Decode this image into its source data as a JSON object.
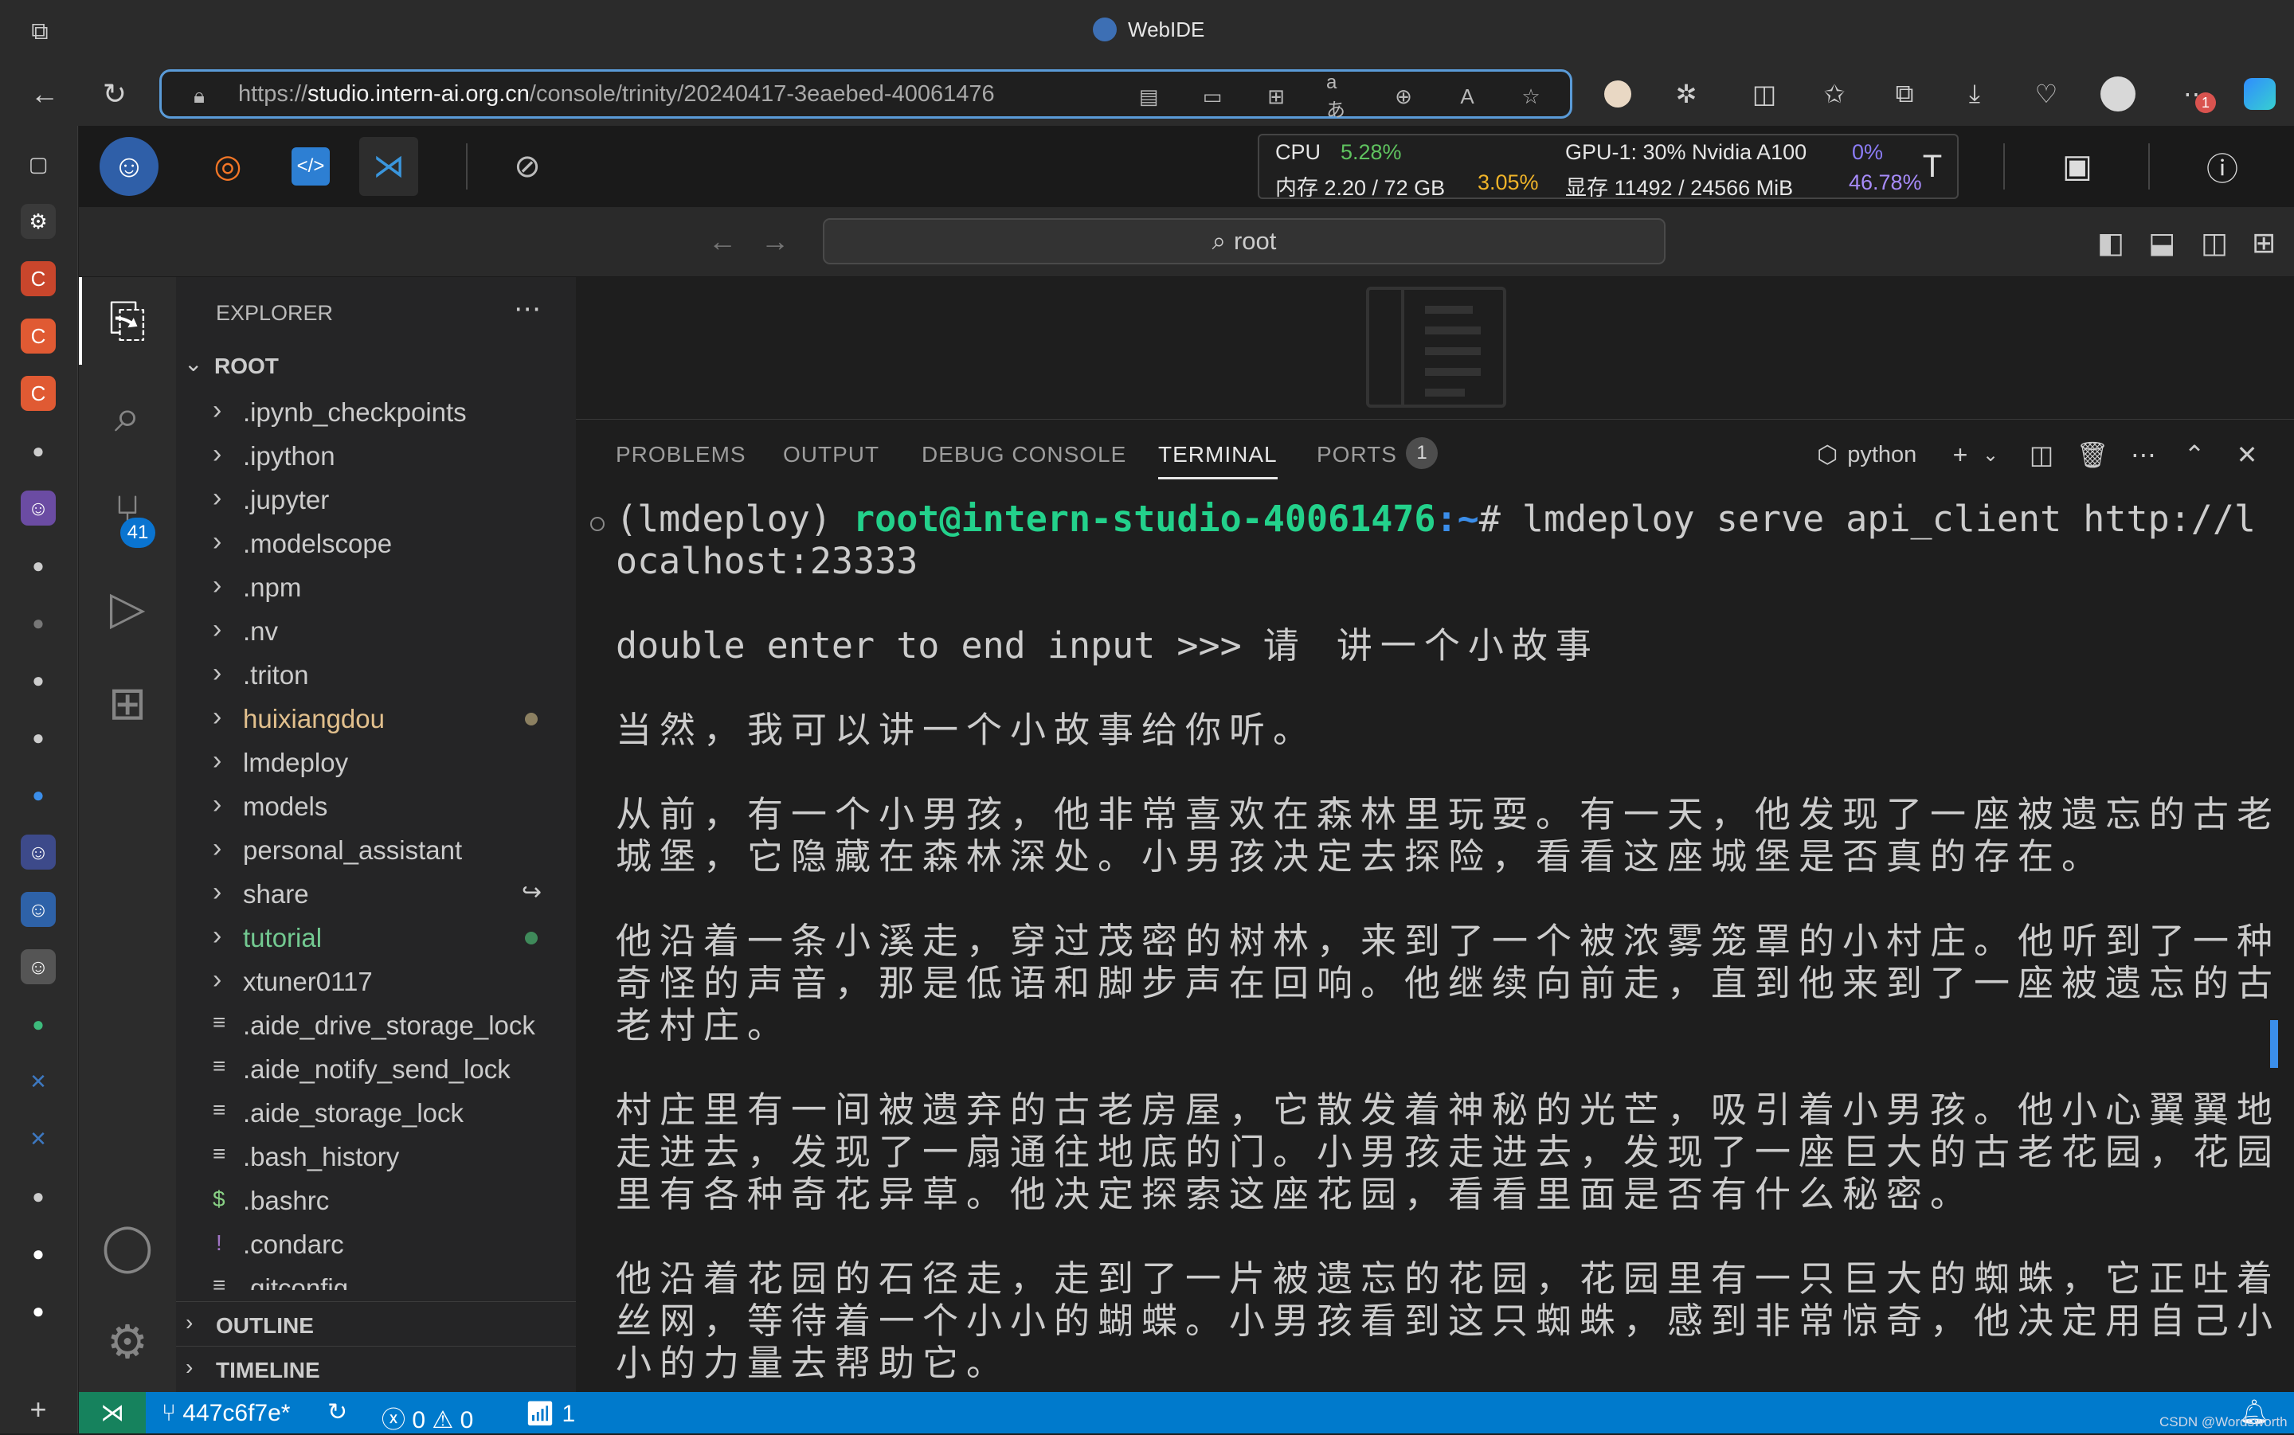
{
  "browser": {
    "window_title": "WebIDE",
    "url_prefix": "https://",
    "url_host": "studio.intern-ai.org.cn",
    "url_path": "/console/trinity/20240417-3eaebed-40061476",
    "download_badge": "1"
  },
  "ide_toolbar": {
    "cpu_label": "CPU",
    "cpu_value": "5.28%",
    "mem_label": "内存 2.20 / 72 GB",
    "mem_value": "3.05%",
    "gpu_label": "GPU-1: 30% Nvidia A100",
    "gpu_value": "0%",
    "vram_label": "显存 11492 / 24566 MiB",
    "vram_value": "46.78%"
  },
  "command_center": {
    "text": "root"
  },
  "activity": {
    "scm_badge": "41"
  },
  "explorer": {
    "title": "EXPLORER",
    "root": "ROOT",
    "items": [
      {
        "name": ".ipynb_checkpoints",
        "type": "folder"
      },
      {
        "name": ".ipython",
        "type": "folder"
      },
      {
        "name": ".jupyter",
        "type": "folder"
      },
      {
        "name": ".modelscope",
        "type": "folder"
      },
      {
        "name": ".npm",
        "type": "folder"
      },
      {
        "name": ".nv",
        "type": "folder"
      },
      {
        "name": ".triton",
        "type": "folder"
      },
      {
        "name": "huixiangdou",
        "type": "folder",
        "status": "modified"
      },
      {
        "name": "lmdeploy",
        "type": "folder"
      },
      {
        "name": "models",
        "type": "folder"
      },
      {
        "name": "personal_assistant",
        "type": "folder"
      },
      {
        "name": "share",
        "type": "folder",
        "status": "symlink"
      },
      {
        "name": "tutorial",
        "type": "folder",
        "status": "untracked"
      },
      {
        "name": "xtuner0117",
        "type": "folder"
      },
      {
        "name": ".aide_drive_storage_lock",
        "type": "file"
      },
      {
        "name": ".aide_notify_send_lock",
        "type": "file"
      },
      {
        "name": ".aide_storage_lock",
        "type": "file"
      },
      {
        "name": ".bash_history",
        "type": "file"
      },
      {
        "name": ".bashrc",
        "type": "file",
        "icon": "$"
      },
      {
        "name": ".condarc",
        "type": "file",
        "icon": "!"
      },
      {
        "name": ".gitconfig",
        "type": "file"
      }
    ],
    "outline": "OUTLINE",
    "timeline": "TIMELINE"
  },
  "panel": {
    "tabs": [
      "PROBLEMS",
      "OUTPUT",
      "DEBUG CONSOLE",
      "TERMINAL",
      "PORTS"
    ],
    "active_tab": "TERMINAL",
    "ports_badge": "1",
    "shell_name": "python"
  },
  "terminal": {
    "env": "(lmdeploy) ",
    "user_host": "root@intern-studio-40061476",
    "path": ":~",
    "prompt_end": "# ",
    "command_line1": "lmdeploy serve api_client http://l",
    "command_line2": "ocalhost:23333",
    "input_prompt": "double enter to end input >>> ",
    "user_input": "请 讲一个小故事",
    "p1": "当然，我可以讲一个小故事给你听。",
    "p2_l1": "从前，有一个小男孩，他非常喜欢在森林里玩耍。有一天，他发现了一座被遗忘的古老",
    "p2_l2": "城堡，它隐藏在森林深处。小男孩决定去探险，看看这座城堡是否真的存在。",
    "p3_l1": "他沿着一条小溪走，穿过茂密的树林，来到了一个被浓雾笼罩的小村庄。他听到了一种",
    "p3_l2": "奇怪的声音，那是低语和脚步声在回响。他继续向前走，直到他来到了一座被遗忘的古",
    "p3_l3": "老村庄。",
    "p4_l1": "村庄里有一间被遗弃的古老房屋，它散发着神秘的光芒，吸引着小男孩。他小心翼翼地",
    "p4_l2": "走进去，发现了一扇通往地底的门。小男孩走进去，发现了一座巨大的古老花园，花园",
    "p4_l3": "里有各种奇花异草。他决定探索这座花园，看看里面是否有什么秘密。",
    "p5_l1": "他沿着花园的石径走，走到了一片被遗忘的花园，花园里有一只巨大的蜘蛛，它正吐着",
    "p5_l2": "丝网，等待着一个小小的蝴蝶。小男孩看到这只蜘蛛，感到非常惊奇，他决定用自己小",
    "p5_l3": "小的力量去帮助它。"
  },
  "statusbar": {
    "branch": "447c6f7e*",
    "errors": "0",
    "warnings": "0",
    "ports": "1",
    "watermark": "CSDN @Wordsworth"
  },
  "colors": {
    "accent": "#007acc",
    "prompt_green": "#23d18b",
    "path_blue": "#3b8eea",
    "modified": "#e2c08d",
    "untracked": "#73c991"
  }
}
